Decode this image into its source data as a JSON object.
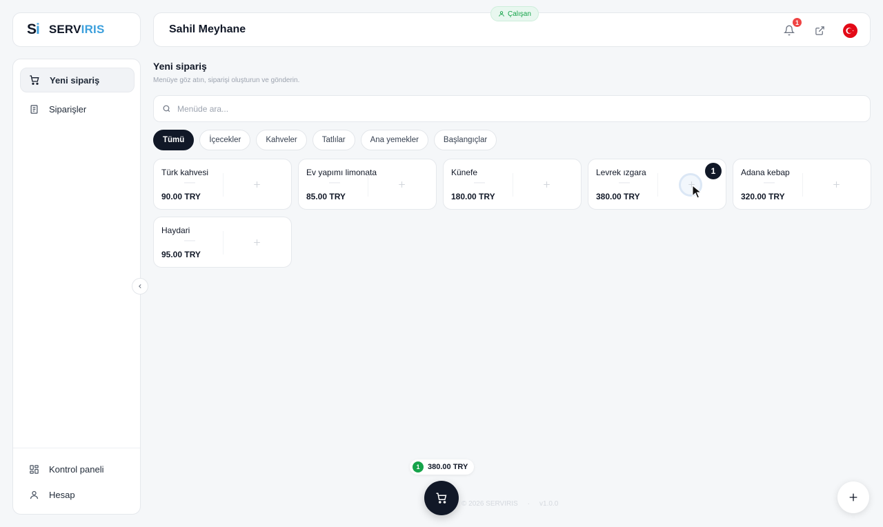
{
  "brand": {
    "mark_s": "S",
    "mark_i": "i",
    "word_a": "SERV",
    "word_b": "IRIS"
  },
  "header": {
    "title": "Sahil Meyhane",
    "role": "Çalışan",
    "notification_count": "1"
  },
  "sidebar": {
    "items": [
      {
        "label": "Yeni sipariş",
        "icon": "cart-plus-icon",
        "active": true
      },
      {
        "label": "Siparişler",
        "icon": "receipt-icon",
        "active": false
      }
    ],
    "bottom_items": [
      {
        "label": "Kontrol paneli",
        "icon": "dashboard-icon"
      },
      {
        "label": "Hesap",
        "icon": "user-icon"
      }
    ]
  },
  "main": {
    "title": "Yeni sipariş",
    "subtitle": "Menüye göz atın, siparişi oluşturun ve gönderin.",
    "search_placeholder": "Menüde ara..."
  },
  "categories": [
    "Tümü",
    "İçecekler",
    "Kahveler",
    "Tatlılar",
    "Ana yemekler",
    "Başlangıçlar"
  ],
  "active_category": "Tümü",
  "products": [
    {
      "name": "Türk kahvesi",
      "price": "90.00 TRY",
      "qty": null
    },
    {
      "name": "Ev yapımı limonata",
      "price": "85.00 TRY",
      "qty": null
    },
    {
      "name": "Künefe",
      "price": "180.00 TRY",
      "qty": null
    },
    {
      "name": "Levrek ızgara",
      "price": "380.00 TRY",
      "qty": "1"
    },
    {
      "name": "Adana kebap",
      "price": "320.00 TRY",
      "qty": null
    },
    {
      "name": "Haydari",
      "price": "95.00 TRY",
      "qty": null
    }
  ],
  "cart": {
    "count": "1",
    "total": "380.00 TRY"
  },
  "footer": {
    "copyright": "© 2026 SERVIRIS",
    "separator": "·",
    "version": "v1.0.0"
  },
  "colors": {
    "accent": "#3b9fdc",
    "dark": "#111827",
    "success": "#16a34a",
    "danger": "#ef4444"
  }
}
